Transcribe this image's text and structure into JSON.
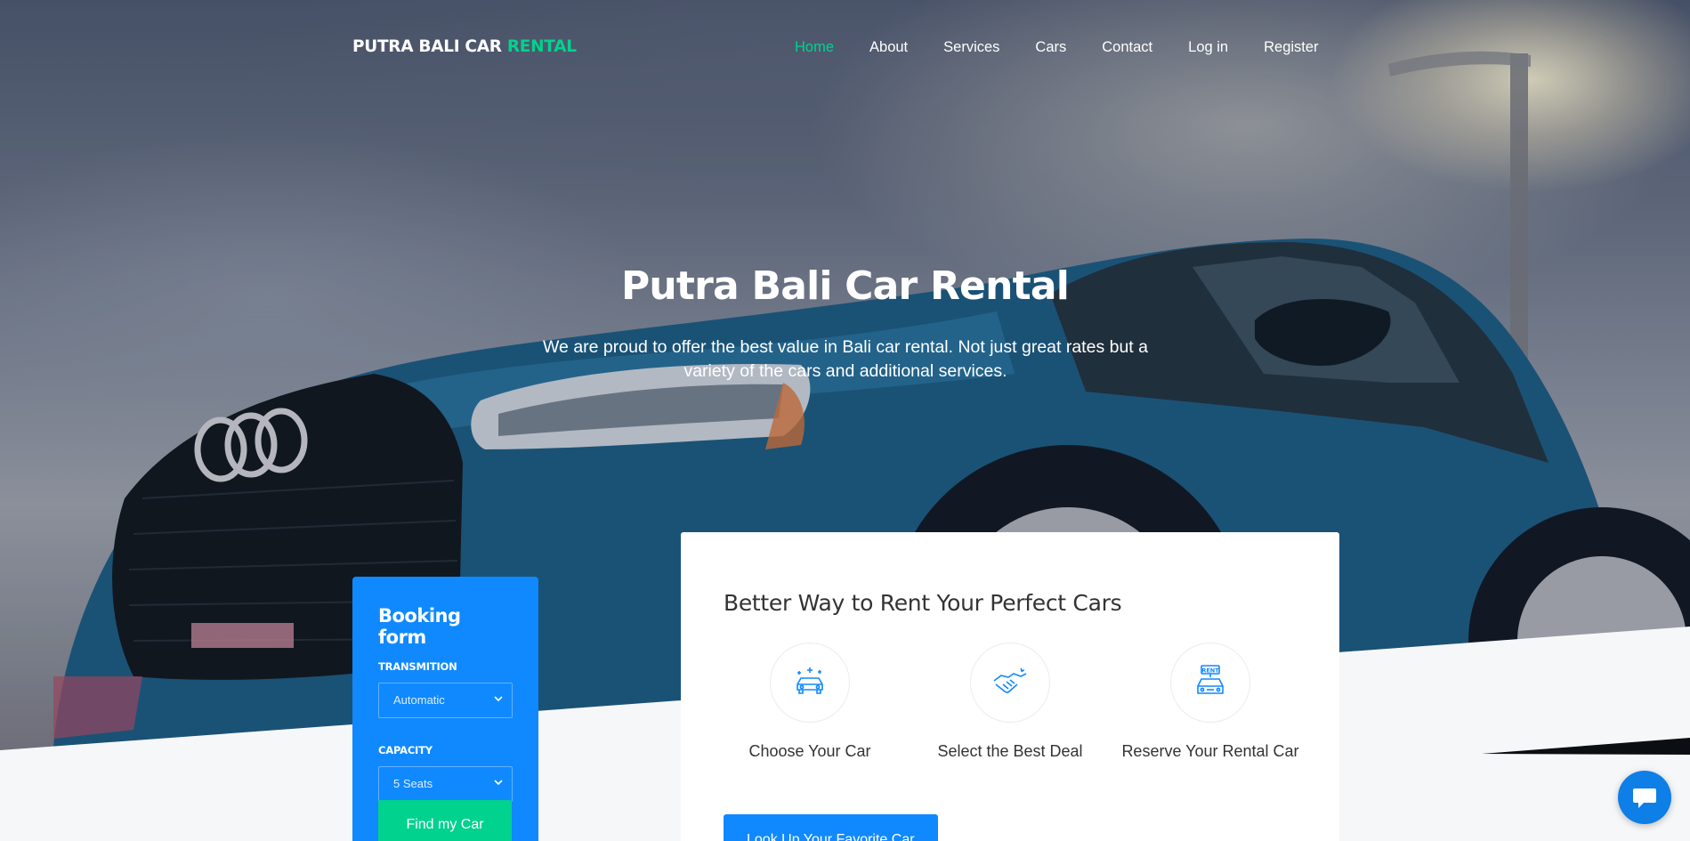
{
  "brand": {
    "name": "PUTRA BALI CAR",
    "accent": "RENTAL"
  },
  "nav": {
    "items": [
      {
        "label": "Home",
        "active": true
      },
      {
        "label": "About"
      },
      {
        "label": "Services"
      },
      {
        "label": "Cars"
      },
      {
        "label": "Contact"
      },
      {
        "label": "Log in"
      },
      {
        "label": "Register"
      }
    ]
  },
  "hero": {
    "title": "Putra Bali Car Rental",
    "subtitle": "We are proud to offer the best value in Bali car rental. Not just great rates but a variety of the cars and additional services."
  },
  "booking": {
    "title": "Booking form",
    "transmission_label": "TRANSMITION",
    "transmission_value": "Automatic",
    "capacity_label": "CAPACITY",
    "capacity_value": "5 Seats",
    "submit_label": "Find my Car"
  },
  "services": {
    "title": "Better Way to Rent Your Perfect Cars",
    "features": [
      {
        "caption": "Choose Your Car",
        "icon": "car-sparkle-icon"
      },
      {
        "caption": "Select the Best Deal",
        "icon": "handshake-icon"
      },
      {
        "caption": "Reserve Your Rental Car",
        "icon": "rent-car-icon"
      }
    ],
    "cta_label": "Look Up Your Favorite Car"
  },
  "chat": {
    "icon": "chat-bubble-icon"
  },
  "colors": {
    "primary": "#1089ff",
    "accent": "#01d28e",
    "text": "#333333"
  }
}
